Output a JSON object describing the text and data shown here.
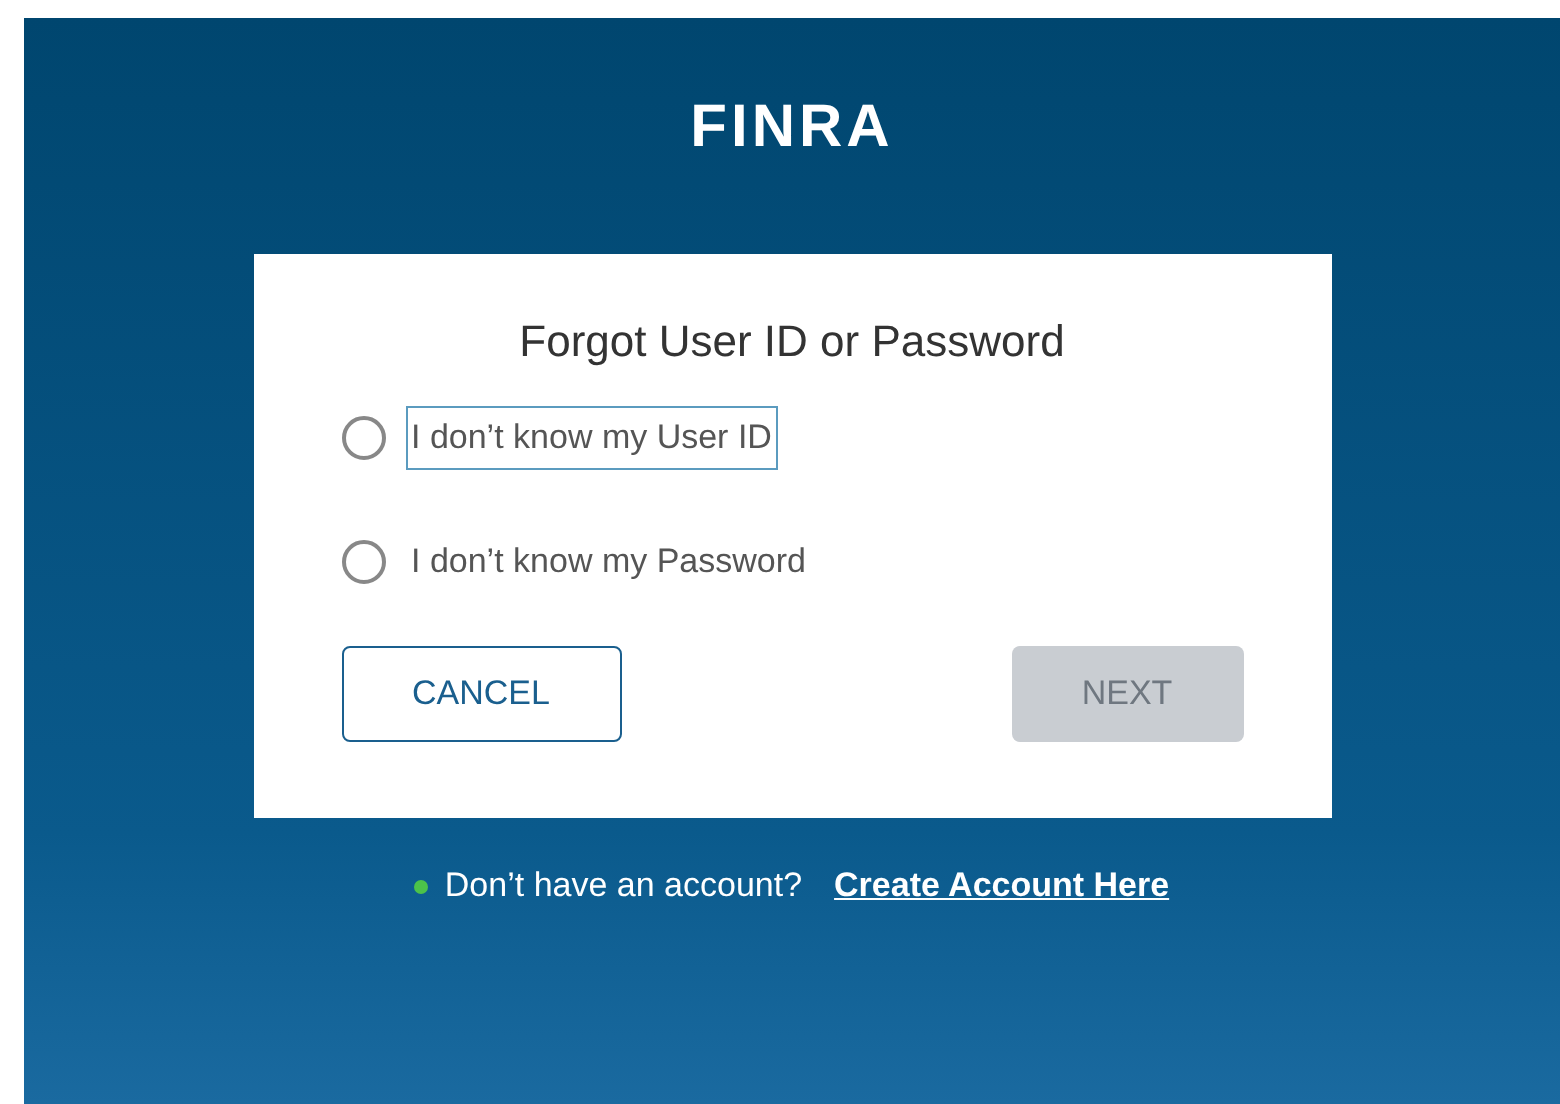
{
  "logo": "FINRA",
  "dialog": {
    "title": "Forgot User ID or Password",
    "options": [
      {
        "label": "I don’t know my User ID",
        "selected": false,
        "focused": true
      },
      {
        "label": "I don’t know my Password",
        "selected": false,
        "focused": false
      }
    ],
    "buttons": [
      {
        "label": "CANCEL",
        "kind": "secondary",
        "disabled": false
      },
      {
        "label": "NEXT",
        "kind": "primary",
        "disabled": true
      }
    ]
  },
  "footer": {
    "text": "Don’t have an account?",
    "link": "Create Account Here"
  }
}
